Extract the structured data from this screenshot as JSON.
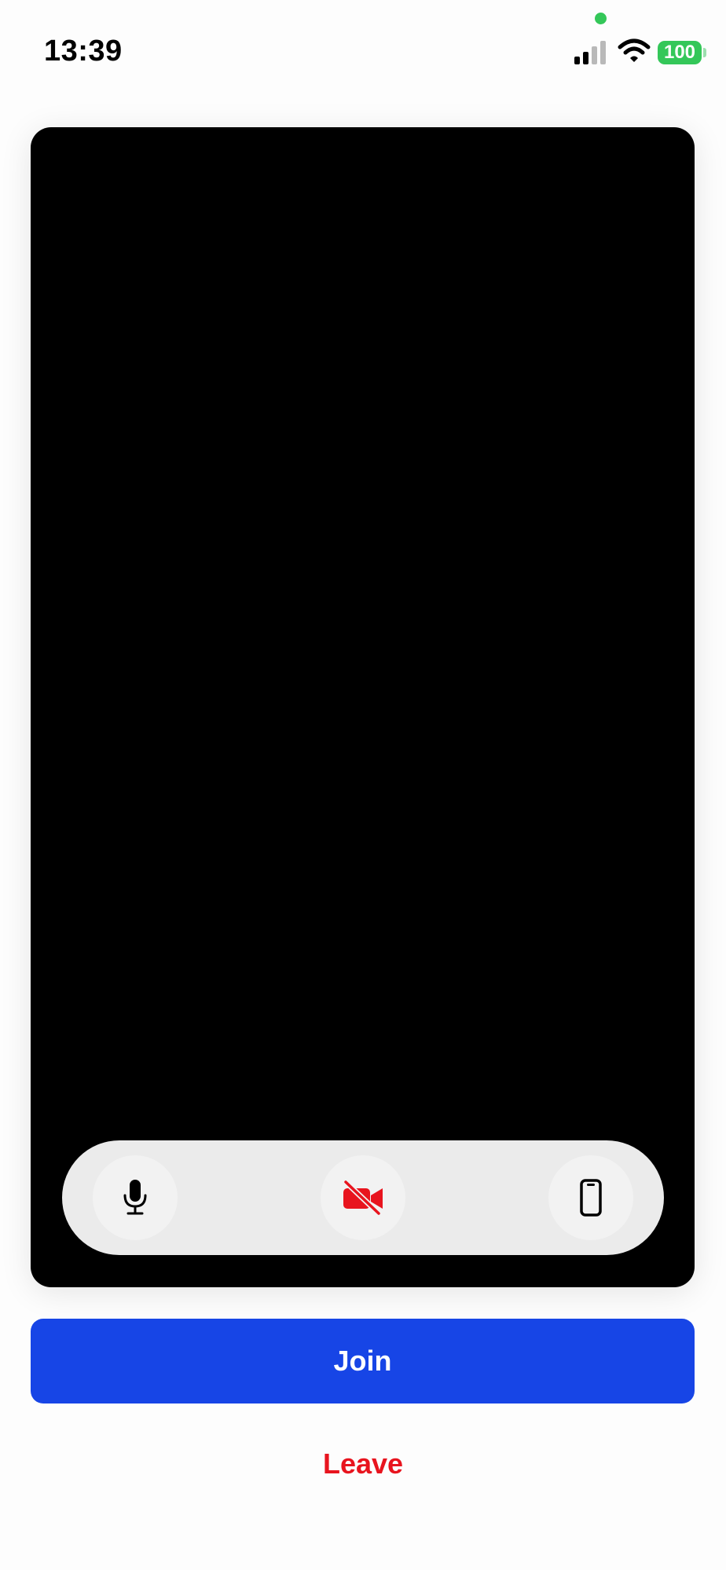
{
  "status_bar": {
    "time": "13:39",
    "battery_level": "100",
    "icons": [
      "privacy-dot",
      "cellular-signal-icon",
      "wifi-icon",
      "battery-icon"
    ]
  },
  "preview": {
    "controls": [
      {
        "name": "microphone-icon",
        "state": "on"
      },
      {
        "name": "camera-off-icon",
        "state": "off"
      },
      {
        "name": "device-icon",
        "state": "default"
      }
    ]
  },
  "actions": {
    "join_label": "Join",
    "leave_label": "Leave"
  },
  "colors": {
    "accent": "#1745e6",
    "danger": "#e8141e",
    "battery": "#34c759",
    "preview_bg": "#000000",
    "control_bar_bg": "#ebebeb"
  }
}
